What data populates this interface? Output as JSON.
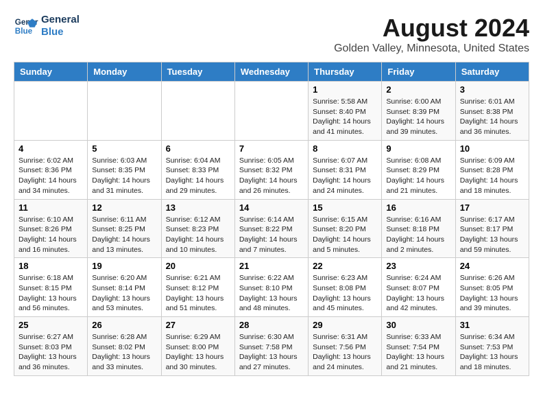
{
  "logo": {
    "line1": "General",
    "line2": "Blue"
  },
  "title": "August 2024",
  "location": "Golden Valley, Minnesota, United States",
  "weekdays": [
    "Sunday",
    "Monday",
    "Tuesday",
    "Wednesday",
    "Thursday",
    "Friday",
    "Saturday"
  ],
  "weeks": [
    [
      {
        "day": "",
        "info": ""
      },
      {
        "day": "",
        "info": ""
      },
      {
        "day": "",
        "info": ""
      },
      {
        "day": "",
        "info": ""
      },
      {
        "day": "1",
        "info": "Sunrise: 5:58 AM\nSunset: 8:40 PM\nDaylight: 14 hours and 41 minutes."
      },
      {
        "day": "2",
        "info": "Sunrise: 6:00 AM\nSunset: 8:39 PM\nDaylight: 14 hours and 39 minutes."
      },
      {
        "day": "3",
        "info": "Sunrise: 6:01 AM\nSunset: 8:38 PM\nDaylight: 14 hours and 36 minutes."
      }
    ],
    [
      {
        "day": "4",
        "info": "Sunrise: 6:02 AM\nSunset: 8:36 PM\nDaylight: 14 hours and 34 minutes."
      },
      {
        "day": "5",
        "info": "Sunrise: 6:03 AM\nSunset: 8:35 PM\nDaylight: 14 hours and 31 minutes."
      },
      {
        "day": "6",
        "info": "Sunrise: 6:04 AM\nSunset: 8:33 PM\nDaylight: 14 hours and 29 minutes."
      },
      {
        "day": "7",
        "info": "Sunrise: 6:05 AM\nSunset: 8:32 PM\nDaylight: 14 hours and 26 minutes."
      },
      {
        "day": "8",
        "info": "Sunrise: 6:07 AM\nSunset: 8:31 PM\nDaylight: 14 hours and 24 minutes."
      },
      {
        "day": "9",
        "info": "Sunrise: 6:08 AM\nSunset: 8:29 PM\nDaylight: 14 hours and 21 minutes."
      },
      {
        "day": "10",
        "info": "Sunrise: 6:09 AM\nSunset: 8:28 PM\nDaylight: 14 hours and 18 minutes."
      }
    ],
    [
      {
        "day": "11",
        "info": "Sunrise: 6:10 AM\nSunset: 8:26 PM\nDaylight: 14 hours and 16 minutes."
      },
      {
        "day": "12",
        "info": "Sunrise: 6:11 AM\nSunset: 8:25 PM\nDaylight: 14 hours and 13 minutes."
      },
      {
        "day": "13",
        "info": "Sunrise: 6:12 AM\nSunset: 8:23 PM\nDaylight: 14 hours and 10 minutes."
      },
      {
        "day": "14",
        "info": "Sunrise: 6:14 AM\nSunset: 8:22 PM\nDaylight: 14 hours and 7 minutes."
      },
      {
        "day": "15",
        "info": "Sunrise: 6:15 AM\nSunset: 8:20 PM\nDaylight: 14 hours and 5 minutes."
      },
      {
        "day": "16",
        "info": "Sunrise: 6:16 AM\nSunset: 8:18 PM\nDaylight: 14 hours and 2 minutes."
      },
      {
        "day": "17",
        "info": "Sunrise: 6:17 AM\nSunset: 8:17 PM\nDaylight: 13 hours and 59 minutes."
      }
    ],
    [
      {
        "day": "18",
        "info": "Sunrise: 6:18 AM\nSunset: 8:15 PM\nDaylight: 13 hours and 56 minutes."
      },
      {
        "day": "19",
        "info": "Sunrise: 6:20 AM\nSunset: 8:14 PM\nDaylight: 13 hours and 53 minutes."
      },
      {
        "day": "20",
        "info": "Sunrise: 6:21 AM\nSunset: 8:12 PM\nDaylight: 13 hours and 51 minutes."
      },
      {
        "day": "21",
        "info": "Sunrise: 6:22 AM\nSunset: 8:10 PM\nDaylight: 13 hours and 48 minutes."
      },
      {
        "day": "22",
        "info": "Sunrise: 6:23 AM\nSunset: 8:08 PM\nDaylight: 13 hours and 45 minutes."
      },
      {
        "day": "23",
        "info": "Sunrise: 6:24 AM\nSunset: 8:07 PM\nDaylight: 13 hours and 42 minutes."
      },
      {
        "day": "24",
        "info": "Sunrise: 6:26 AM\nSunset: 8:05 PM\nDaylight: 13 hours and 39 minutes."
      }
    ],
    [
      {
        "day": "25",
        "info": "Sunrise: 6:27 AM\nSunset: 8:03 PM\nDaylight: 13 hours and 36 minutes."
      },
      {
        "day": "26",
        "info": "Sunrise: 6:28 AM\nSunset: 8:02 PM\nDaylight: 13 hours and 33 minutes."
      },
      {
        "day": "27",
        "info": "Sunrise: 6:29 AM\nSunset: 8:00 PM\nDaylight: 13 hours and 30 minutes."
      },
      {
        "day": "28",
        "info": "Sunrise: 6:30 AM\nSunset: 7:58 PM\nDaylight: 13 hours and 27 minutes."
      },
      {
        "day": "29",
        "info": "Sunrise: 6:31 AM\nSunset: 7:56 PM\nDaylight: 13 hours and 24 minutes."
      },
      {
        "day": "30",
        "info": "Sunrise: 6:33 AM\nSunset: 7:54 PM\nDaylight: 13 hours and 21 minutes."
      },
      {
        "day": "31",
        "info": "Sunrise: 6:34 AM\nSunset: 7:53 PM\nDaylight: 13 hours and 18 minutes."
      }
    ]
  ]
}
